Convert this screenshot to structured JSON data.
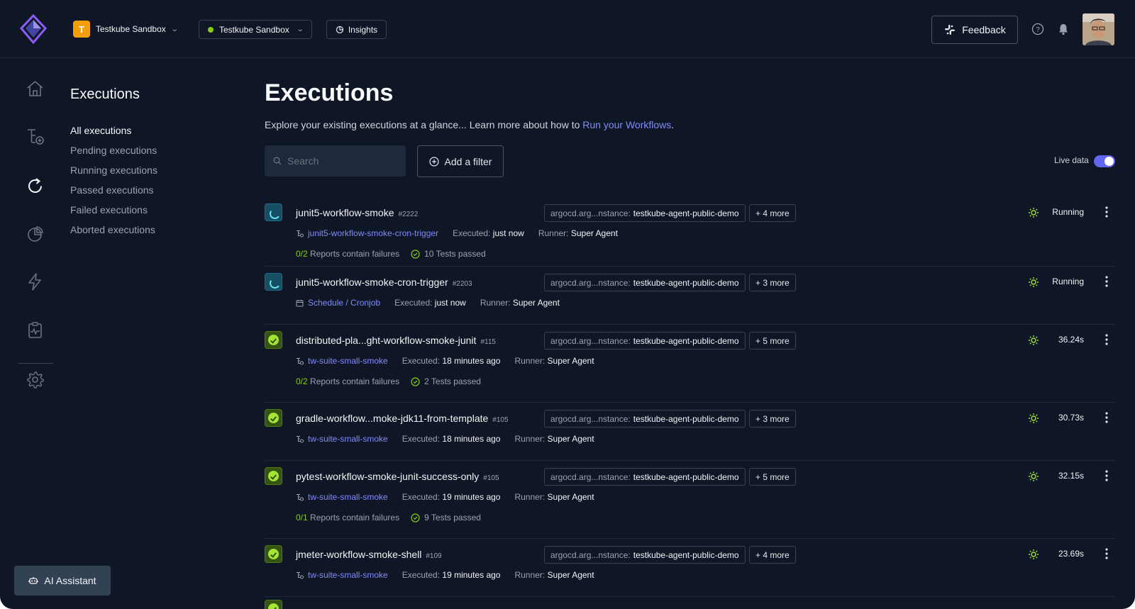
{
  "header": {
    "org_initial": "T",
    "org_name": "Testkube Sandbox",
    "env_name": "Testkube Sandbox",
    "insights_label": "Insights",
    "feedback_label": "Feedback"
  },
  "subnav": {
    "title": "Executions",
    "items": [
      {
        "label": "All executions",
        "active": true
      },
      {
        "label": "Pending executions"
      },
      {
        "label": "Running executions"
      },
      {
        "label": "Passed executions"
      },
      {
        "label": "Failed executions"
      },
      {
        "label": "Aborted executions"
      }
    ]
  },
  "ai_assistant_label": "AI Assistant",
  "main": {
    "title": "Executions",
    "description": "Explore your existing executions at a glance... Learn more about how to ",
    "description_link": "Run your Workflows",
    "description_end": ".",
    "search_placeholder": "Search",
    "add_filter_label": "Add a filter",
    "live_data_label": "Live data",
    "live_data_on": true
  },
  "labels": {
    "executed": "Executed:",
    "runner": "Runner:",
    "reports_text": "Reports contain failures"
  },
  "executions": [
    {
      "status": "running",
      "name": "junit5-workflow-smoke",
      "number": "#2222",
      "tag_key": "argocd.arg...nstance:",
      "tag_value": "testkube-agent-public-demo",
      "more": "+ 4 more",
      "duration": "Running",
      "trigger_type": "workflow",
      "trigger": "junit5-workflow-smoke-cron-trigger",
      "executed": "just now",
      "runner": "Super Agent",
      "reports_ratio": "0/2",
      "tests_passed": "10 Tests passed"
    },
    {
      "status": "running",
      "name": "junit5-workflow-smoke-cron-trigger",
      "number": "#2203",
      "tag_key": "argocd.arg...nstance:",
      "tag_value": "testkube-agent-public-demo",
      "more": "+ 3 more",
      "duration": "Running",
      "trigger_type": "schedule",
      "trigger": "Schedule / Cronjob",
      "executed": "just now",
      "runner": "Super Agent"
    },
    {
      "status": "passed",
      "name": "distributed-pla...ght-workflow-smoke-junit",
      "number": "#115",
      "tag_key": "argocd.arg...nstance:",
      "tag_value": "testkube-agent-public-demo",
      "more": "+ 5 more",
      "duration": "36.24s",
      "trigger_type": "workflow",
      "trigger": "tw-suite-small-smoke",
      "executed": "18 minutes ago",
      "runner": "Super Agent",
      "reports_ratio": "0/2",
      "tests_passed": "2 Tests passed"
    },
    {
      "status": "passed",
      "name": "gradle-workflow...moke-jdk11-from-template",
      "number": "#105",
      "tag_key": "argocd.arg...nstance:",
      "tag_value": "testkube-agent-public-demo",
      "more": "+ 3 more",
      "duration": "30.73s",
      "trigger_type": "workflow",
      "trigger": "tw-suite-small-smoke",
      "executed": "18 minutes ago",
      "runner": "Super Agent"
    },
    {
      "status": "passed",
      "name": "pytest-workflow-smoke-junit-success-only",
      "number": "#105",
      "tag_key": "argocd.arg...nstance:",
      "tag_value": "testkube-agent-public-demo",
      "more": "+ 5 more",
      "duration": "32.15s",
      "trigger_type": "workflow",
      "trigger": "tw-suite-small-smoke",
      "executed": "19 minutes ago",
      "runner": "Super Agent",
      "reports_ratio": "0/1",
      "tests_passed": "9 Tests passed"
    },
    {
      "status": "passed",
      "name": "jmeter-workflow-smoke-shell",
      "number": "#109",
      "tag_key": "argocd.arg...nstance:",
      "tag_value": "testkube-agent-public-demo",
      "more": "+ 4 more",
      "duration": "23.69s",
      "trigger_type": "workflow",
      "trigger": "tw-suite-small-smoke",
      "executed": "19 minutes ago",
      "runner": "Super Agent"
    }
  ],
  "colors": {
    "background": "#0f1626",
    "accent": "#6366f1",
    "link": "#818cf8",
    "success": "#a3e635",
    "running": "#67e8f9"
  }
}
